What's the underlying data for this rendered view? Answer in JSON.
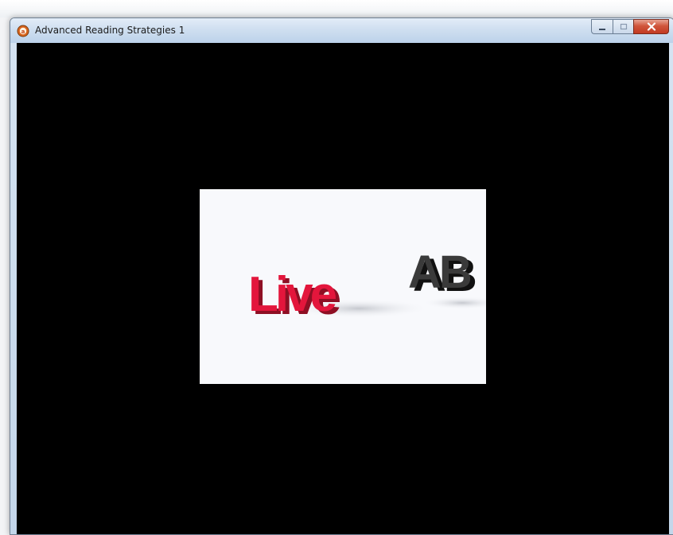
{
  "window": {
    "title": "Advanced Reading Strategies 1",
    "app_icon": "media-player-icon",
    "buttons": {
      "minimize": "minimize-icon",
      "maximize": "maximize-icon",
      "close": "close-icon"
    }
  },
  "video_frame": {
    "logo_text_red": "Live",
    "logo_text_dark": "AB",
    "colors": {
      "red": "#e3163c",
      "dark": "#2a2a2a",
      "background": "#f8f9fc"
    }
  }
}
